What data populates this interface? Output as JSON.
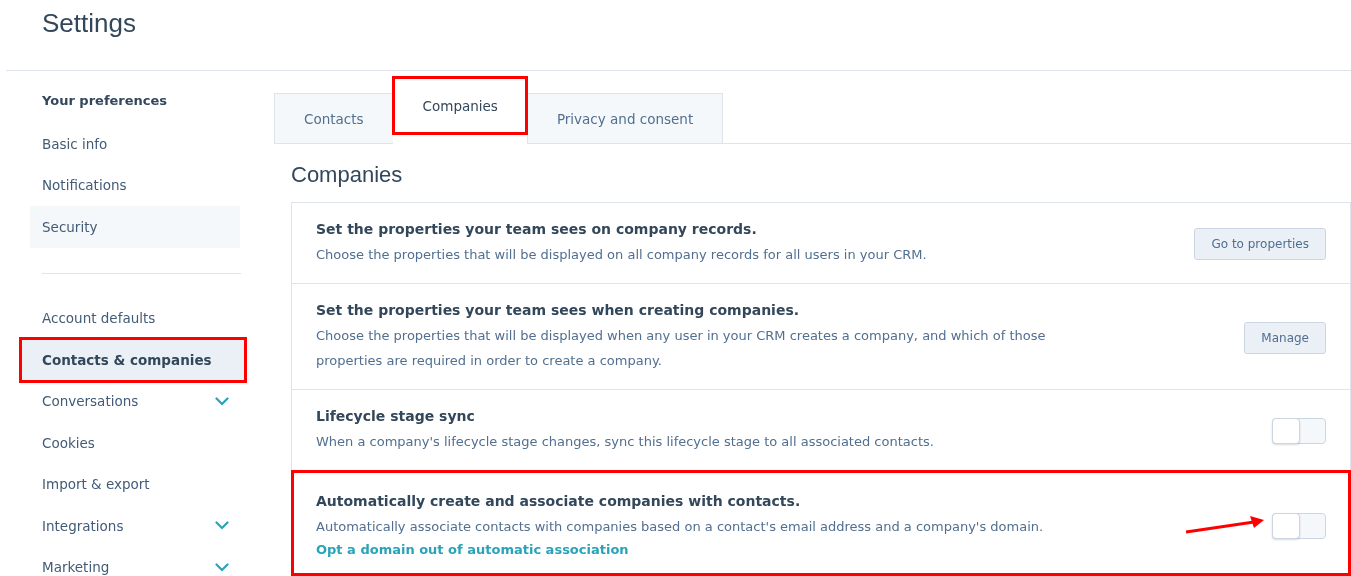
{
  "page_title": "Settings",
  "sidebar": {
    "sections": [
      {
        "heading": "Your preferences",
        "items": [
          {
            "label": "Basic info",
            "selected": false,
            "hovered": false,
            "expandable": false,
            "annotated": false
          },
          {
            "label": "Notifications",
            "selected": false,
            "hovered": false,
            "expandable": false,
            "annotated": false
          },
          {
            "label": "Security",
            "selected": false,
            "hovered": true,
            "expandable": false,
            "annotated": false
          }
        ]
      },
      {
        "items": [
          {
            "label": "Account defaults",
            "selected": false,
            "hovered": false,
            "expandable": false,
            "annotated": false
          },
          {
            "label": "Contacts & companies",
            "selected": true,
            "hovered": false,
            "expandable": false,
            "annotated": true
          },
          {
            "label": "Conversations",
            "selected": false,
            "hovered": false,
            "expandable": true,
            "annotated": false
          },
          {
            "label": "Cookies",
            "selected": false,
            "hovered": false,
            "expandable": false,
            "annotated": false
          },
          {
            "label": "Import & export",
            "selected": false,
            "hovered": false,
            "expandable": false,
            "annotated": false
          },
          {
            "label": "Integrations",
            "selected": false,
            "hovered": false,
            "expandable": true,
            "annotated": false
          },
          {
            "label": "Marketing",
            "selected": false,
            "hovered": false,
            "expandable": true,
            "annotated": false
          }
        ]
      }
    ]
  },
  "tabs": [
    {
      "label": "Contacts",
      "selected": false,
      "annotated": false
    },
    {
      "label": "Companies",
      "selected": true,
      "annotated": true
    },
    {
      "label": "Privacy and consent",
      "selected": false,
      "annotated": false
    }
  ],
  "section_title": "Companies",
  "settings": [
    {
      "kind": "button",
      "title": "Set the properties your team sees on company records.",
      "description": "Choose the properties that will be displayed on all company records for all users in your CRM.",
      "button": "Go to properties",
      "annotated": false
    },
    {
      "kind": "button",
      "title": "Set the properties your team sees when creating companies.",
      "description": "Choose the properties that will be displayed when any user in your CRM creates a company, and which of those properties are required in order to create a company.",
      "button": "Manage",
      "annotated": false
    },
    {
      "kind": "toggle",
      "title": "Lifecycle stage sync",
      "description": "When a company's lifecycle stage changes, sync this lifecycle stage to all associated contacts.",
      "on": false,
      "annotated": false,
      "arrow": false
    },
    {
      "kind": "toggle",
      "title": "Automatically create and associate companies with contacts.",
      "description": "Automatically associate contacts with companies based on a contact's email address and a company's domain.",
      "link": "Opt a domain out of automatic association",
      "on": false,
      "annotated": true,
      "arrow": true
    }
  ]
}
